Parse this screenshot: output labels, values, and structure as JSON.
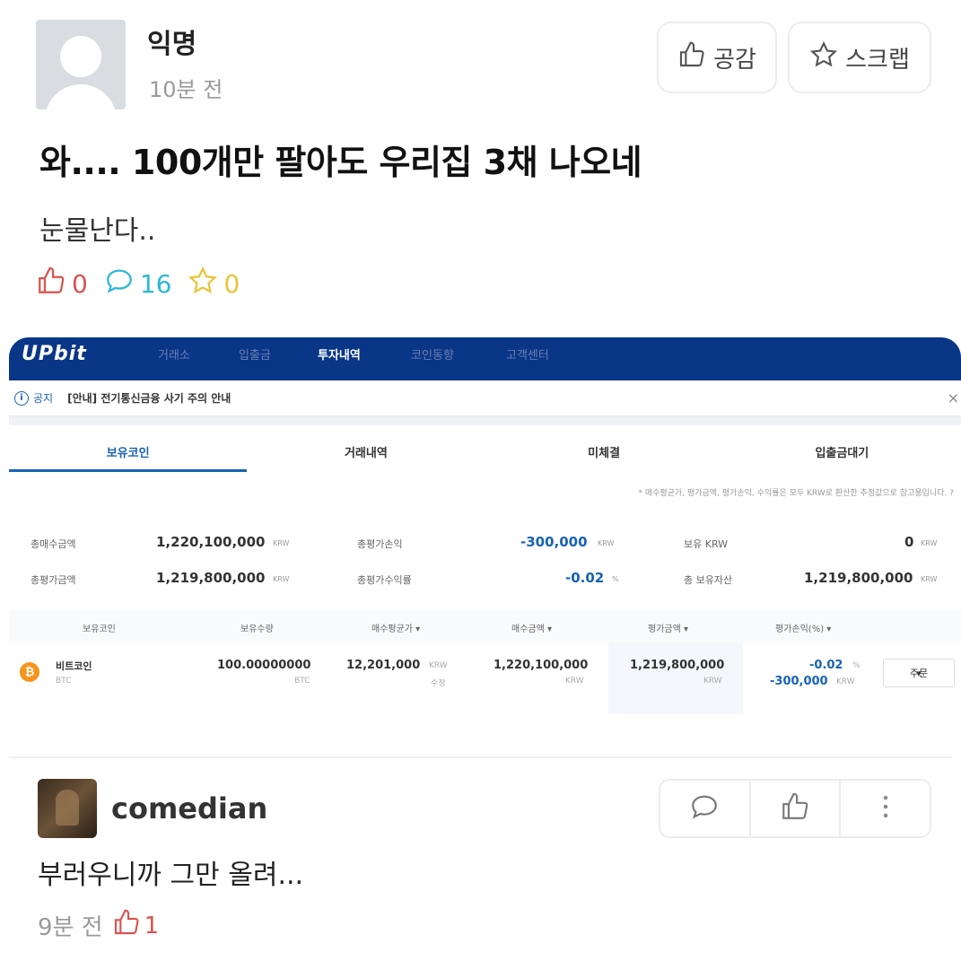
{
  "post": {
    "author": "익명",
    "time": "10분 전",
    "like_button": "공감",
    "scrap_button": "스크랩",
    "title": "와.... 100개만 팔아도 우리집 3채 나오네",
    "body": "눈물난다..",
    "stats": {
      "likes": "0",
      "comments": "16",
      "scraps": "0"
    }
  },
  "upbit": {
    "logo": "UPbit",
    "nav": [
      "거래소",
      "입출금",
      "투자내역",
      "코인동향",
      "고객센터"
    ],
    "notice": {
      "label": "공지",
      "text": "[안내] 전기통신금융 사기 주의 안내",
      "close": "×"
    },
    "tabs": [
      "보유코인",
      "거래내역",
      "미체결",
      "입출금대기"
    ],
    "note": "* 매수평균가, 평가금액, 평가손익, 수익률은 모두 KRW로 환산한 추정값으로 참고용입니다. ?",
    "summary": {
      "total_buy_label": "총매수금액",
      "total_buy": "1,220,100,000",
      "total_eval_label": "총평가금액",
      "total_eval": "1,219,800,000",
      "pnl_label": "총평가손익",
      "pnl": "-300,000",
      "pnl_rate_label": "총평가수익률",
      "pnl_rate": "-0.02",
      "krw_label": "보유 KRW",
      "krw": "0",
      "assets_label": "총 보유자산",
      "assets": "1,219,800,000",
      "unit": "KRW",
      "pct": "%"
    },
    "table": {
      "headers": [
        "보유코인",
        "보유수량",
        "매수평균가 ▾",
        "매수금액 ▾",
        "평가금액 ▾",
        "평가손익(%) ▾"
      ],
      "row": {
        "coin": "비트코인",
        "symbol": "BTC",
        "qty": "100.00000000",
        "qty_unit": "BTC",
        "avg_price": "12,201,000",
        "avg_unit": "KRW",
        "avg_edit": "수정",
        "buy_amount": "1,220,100,000",
        "buy_unit": "KRW",
        "eval_amount": "1,219,800,000",
        "eval_unit": "KRW",
        "pnl_rate": "-0.02",
        "pnl_rate_unit": "%",
        "pnl": "-300,000",
        "pnl_unit": "KRW",
        "order": "주문"
      }
    }
  },
  "comment": {
    "author": "comedian",
    "body": "부러우니까 그만 올려...",
    "time": "9분 전",
    "likes": "1"
  },
  "colors": {
    "upbit_blue": "#093687",
    "accent_blue": "#1763b6",
    "like_red": "#d9534f",
    "comment_cyan": "#2bb7d6",
    "scrap_yellow": "#e8c53a"
  }
}
